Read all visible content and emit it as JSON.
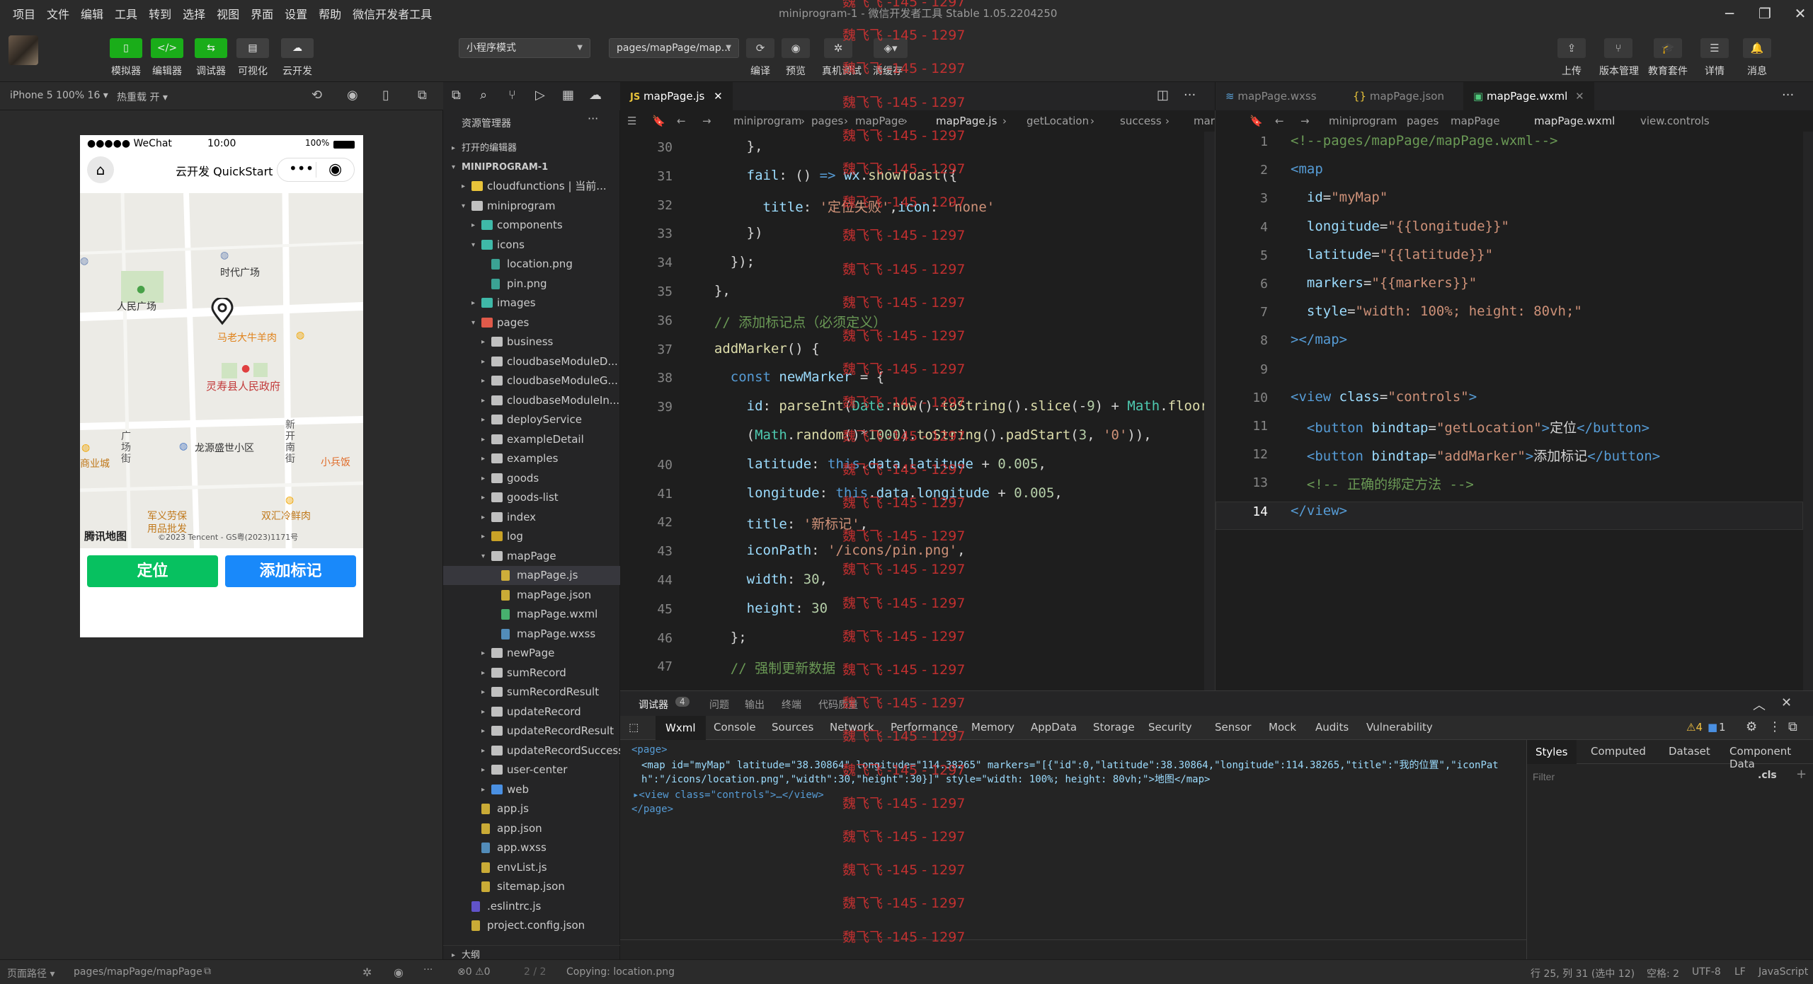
{
  "menu": [
    "项目",
    "文件",
    "编辑",
    "工具",
    "转到",
    "选择",
    "视图",
    "界面",
    "设置",
    "帮助",
    "微信开发者工具"
  ],
  "window_title": "miniprogram-1 - 微信开发者工具 Stable 1.05.2204250",
  "toolbar": {
    "buttons": [
      "模拟器",
      "编辑器",
      "调试器",
      "可视化",
      "云开发"
    ],
    "mode_select": "小程序模式",
    "page_select": "pages/mapPage/map...",
    "actions": [
      "编译",
      "预览",
      "真机调试",
      "清缓存"
    ],
    "right": [
      "上传",
      "版本管理",
      "教育套件",
      "详情",
      "消息"
    ]
  },
  "simulator": {
    "device": "iPhone 5 100% 16 ▾",
    "hot_reload": "热重载 开 ▾",
    "status_left": "●●●●● WeChat",
    "status_time": "10:00",
    "status_batt": "100%",
    "nav_title": "云开发 QuickStart",
    "map_labels": {
      "square": "时代广场",
      "park": "人民广场",
      "restaurant": "马老大牛羊肉",
      "gov": "灵寿县人民政府",
      "community": "龙源盛世小区",
      "mall": "商业城",
      "street1": "新开南街",
      "street2": "广场街",
      "shop": "小兵饭",
      "army": "军义劳保\n用品批发",
      "beef": "双汇冷鲜肉",
      "brand": "腾讯地图",
      "copyright": "©2023 Tencent - GS粤(2023)1171号"
    },
    "btn_locate": "定位",
    "btn_add": "添加标记"
  },
  "explorer": {
    "title": "资源管理器",
    "sections": {
      "open": "打开的编辑器",
      "project": "MINIPROGRAM-1",
      "outline": "大纲"
    },
    "rows": [
      {
        "label": "cloudfunctions | 当前...",
        "depth": 1,
        "type": "folder-cloud",
        "arrow": "▸"
      },
      {
        "label": "miniprogram",
        "depth": 1,
        "type": "folder",
        "arrow": "▾"
      },
      {
        "label": "components",
        "depth": 2,
        "type": "folder-teal",
        "arrow": "▸"
      },
      {
        "label": "icons",
        "depth": 2,
        "type": "folder-teal",
        "arrow": "▾"
      },
      {
        "label": "location.png",
        "depth": 3,
        "type": "img",
        "arrow": ""
      },
      {
        "label": "pin.png",
        "depth": 3,
        "type": "img",
        "arrow": ""
      },
      {
        "label": "images",
        "depth": 2,
        "type": "folder-teal",
        "arrow": "▸"
      },
      {
        "label": "pages",
        "depth": 2,
        "type": "folder-red",
        "arrow": "▾"
      },
      {
        "label": "business",
        "depth": 3,
        "type": "folder",
        "arrow": "▸"
      },
      {
        "label": "cloudbaseModuleD...",
        "depth": 3,
        "type": "folder",
        "arrow": "▸"
      },
      {
        "label": "cloudbaseModuleG...",
        "depth": 3,
        "type": "folder",
        "arrow": "▸"
      },
      {
        "label": "cloudbaseModuleIn...",
        "depth": 3,
        "type": "folder",
        "arrow": "▸"
      },
      {
        "label": "deployService",
        "depth": 3,
        "type": "folder",
        "arrow": "▸"
      },
      {
        "label": "exampleDetail",
        "depth": 3,
        "type": "folder",
        "arrow": "▸"
      },
      {
        "label": "examples",
        "depth": 3,
        "type": "folder",
        "arrow": "▸"
      },
      {
        "label": "goods",
        "depth": 3,
        "type": "folder",
        "arrow": "▸"
      },
      {
        "label": "goods-list",
        "depth": 3,
        "type": "folder",
        "arrow": "▸"
      },
      {
        "label": "index",
        "depth": 3,
        "type": "folder",
        "arrow": "▸"
      },
      {
        "label": "log",
        "depth": 3,
        "type": "folder-yellow",
        "arrow": "▸"
      },
      {
        "label": "mapPage",
        "depth": 3,
        "type": "folder",
        "arrow": "▾"
      },
      {
        "label": "mapPage.js",
        "depth": 4,
        "type": "js",
        "arrow": "",
        "selected": true
      },
      {
        "label": "mapPage.json",
        "depth": 4,
        "type": "json",
        "arrow": ""
      },
      {
        "label": "mapPage.wxml",
        "depth": 4,
        "type": "wxml",
        "arrow": ""
      },
      {
        "label": "mapPage.wxss",
        "depth": 4,
        "type": "wxss",
        "arrow": ""
      },
      {
        "label": "newPage",
        "depth": 3,
        "type": "folder",
        "arrow": "▸"
      },
      {
        "label": "sumRecord",
        "depth": 3,
        "type": "folder",
        "arrow": "▸"
      },
      {
        "label": "sumRecordResult",
        "depth": 3,
        "type": "folder",
        "arrow": "▸"
      },
      {
        "label": "updateRecord",
        "depth": 3,
        "type": "folder",
        "arrow": "▸"
      },
      {
        "label": "updateRecordResult",
        "depth": 3,
        "type": "folder",
        "arrow": "▸"
      },
      {
        "label": "updateRecordSuccess",
        "depth": 3,
        "type": "folder",
        "arrow": "▸"
      },
      {
        "label": "user-center",
        "depth": 3,
        "type": "folder",
        "arrow": "▸"
      },
      {
        "label": "web",
        "depth": 3,
        "type": "folder-blue",
        "arrow": "▸"
      },
      {
        "label": "app.js",
        "depth": 2,
        "type": "js",
        "arrow": ""
      },
      {
        "label": "app.json",
        "depth": 2,
        "type": "json",
        "arrow": ""
      },
      {
        "label": "app.wxss",
        "depth": 2,
        "type": "wxss",
        "arrow": ""
      },
      {
        "label": "envList.js",
        "depth": 2,
        "type": "js",
        "arrow": ""
      },
      {
        "label": "sitemap.json",
        "depth": 2,
        "type": "json",
        "arrow": ""
      },
      {
        "label": ".eslintrc.js",
        "depth": 1,
        "type": "eslint",
        "arrow": ""
      },
      {
        "label": "project.config.json",
        "depth": 1,
        "type": "json",
        "arrow": ""
      }
    ]
  },
  "editor_left": {
    "tab": "mapPage.js",
    "crumbs": [
      "miniprogram",
      "pages",
      "mapPage",
      "mapPage.js",
      "getLocation",
      "success",
      "mark"
    ],
    "lines": [
      {
        "n": "30",
        "html": "      },"
      },
      {
        "n": "31",
        "html": "      <span class='p'>fail</span>: () <span class='b'>=></span> <span class='p'>wx</span>.<span class='f'>showToast</span>({"
      },
      {
        "n": "32",
        "html": "        <span class='p'>title</span>: <span class='s'>'定位失败'</span>,<span class='p'>icon</span>: <span class='s'>'none'</span>"
      },
      {
        "n": "33",
        "html": "      })"
      },
      {
        "n": "34",
        "html": "    });"
      },
      {
        "n": "35",
        "html": "  },"
      },
      {
        "n": "36",
        "html": "  <span class='c'>// 添加标记点（必须定义）</span>"
      },
      {
        "n": "37",
        "html": "  <span class='f'>addMarker</span>() {"
      },
      {
        "n": "38",
        "html": "    <span class='b'>const</span> <span class='p'>newMarker</span> = {"
      },
      {
        "n": "39",
        "html": "      <span class='p'>id</span>: <span class='f'>parseInt</span>(<span class='t'>Date</span>.<span class='f'>now</span>().<span class='f'>toString</span>().<span class='f'>slice</span>(-<span class='n'>9</span>) + <span class='t'>Math</span>.<span class='f'>floor</span>"
      },
      {
        "n": "",
        "html": "      (<span class='t'>Math</span>.<span class='f'>random</span>()*<span class='n'>1000</span>).<span class='f'>toString</span>().<span class='f'>padStart</span>(<span class='n'>3</span>, <span class='s'>'0'</span>)),"
      },
      {
        "n": "40",
        "html": "      <span class='p'>latitude</span>: <span class='b'>this</span>.<span class='p'>data</span>.<span class='p'>latitude</span> + <span class='n'>0.005</span>,"
      },
      {
        "n": "41",
        "html": "      <span class='p'>longitude</span>: <span class='b'>this</span>.<span class='p'>data</span>.<span class='p'>longitude</span> + <span class='n'>0.005</span>,"
      },
      {
        "n": "42",
        "html": "      <span class='p'>title</span>: <span class='s'>'新标记'</span>,"
      },
      {
        "n": "43",
        "html": "      <span class='p'>iconPath</span>: <span class='s'>'/icons/pin.png'</span>,"
      },
      {
        "n": "44",
        "html": "      <span class='p'>width</span>: <span class='n'>30</span>,"
      },
      {
        "n": "45",
        "html": "      <span class='p'>height</span>: <span class='n'>30</span>"
      },
      {
        "n": "46",
        "html": "    };"
      },
      {
        "n": "47",
        "html": "    <span class='c'>// 强制更新数据</span>"
      }
    ]
  },
  "editor_right": {
    "tabs": [
      "mapPage.wxss",
      "mapPage.json",
      "mapPage.wxml"
    ],
    "crumbs": [
      "miniprogram",
      "pages",
      "mapPage",
      "mapPage.wxml",
      "view.controls"
    ],
    "lines": [
      {
        "n": "1",
        "html": "<span class='c'>&lt;!--pages/mapPage/mapPage.wxml--&gt;</span>"
      },
      {
        "n": "2",
        "html": "<span class='tag'>&lt;map</span>"
      },
      {
        "n": "3",
        "html": "  <span class='attr'>id</span>=<span class='val'>\"myMap\"</span>"
      },
      {
        "n": "4",
        "html": "  <span class='attr'>longitude</span>=<span class='val'>\"{{longitude}}\"</span>"
      },
      {
        "n": "5",
        "html": "  <span class='attr'>latitude</span>=<span class='val'>\"{{latitude}}\"</span>"
      },
      {
        "n": "6",
        "html": "  <span class='attr'>markers</span>=<span class='val'>\"{{markers}}\"</span>"
      },
      {
        "n": "7",
        "html": "  <span class='attr'>style</span>=<span class='val'>\"width: 100%; height: 80vh;\"</span>"
      },
      {
        "n": "8",
        "html": "<span class='tag'>&gt;&lt;/map&gt;</span>"
      },
      {
        "n": "9",
        "html": ""
      },
      {
        "n": "10",
        "html": "<span class='tag'>&lt;view</span> <span class='attr'>class</span>=<span class='val'>\"controls\"</span><span class='tag'>&gt;</span>"
      },
      {
        "n": "11",
        "html": "  <span class='tag'>&lt;button</span> <span class='attr'>bindtap</span>=<span class='val'>\"getLocation\"</span><span class='tag'>&gt;</span>定位<span class='tag'>&lt;/button&gt;</span>"
      },
      {
        "n": "12",
        "html": "  <span class='tag'>&lt;button</span> <span class='attr'>bindtap</span>=<span class='val'>\"addMarker\"</span><span class='tag'>&gt;</span>添加标记<span class='tag'>&lt;/button&gt;</span>"
      },
      {
        "n": "13",
        "html": "  <span class='c'>&lt;!-- 正确的绑定方法 --&gt;</span>"
      },
      {
        "n": "14",
        "html": "<span class='tag'>&lt;/view&gt;</span>"
      }
    ]
  },
  "debugger": {
    "top_tabs": [
      "调试器",
      "4",
      "问题",
      "输出",
      "终端",
      "代码质量"
    ],
    "tabs": [
      "Wxml",
      "Console",
      "Sources",
      "Network",
      "Performance",
      "Memory",
      "AppData",
      "Storage",
      "Security",
      "Sensor",
      "Mock",
      "Audits",
      "Vulnerability"
    ],
    "warn_count": "⚠4",
    "info_count": "1",
    "dom_page_open": "<page>",
    "dom_map": "<map id=\"myMap\" latitude=\"38.30864\" longitude=\"114.38265\" markers=\"[{\"id\":0,\"latitude\":38.30864,\"longitude\":114.38265,\"title\":\"我的位置\",\"iconPath\":\"/icons/location.png\",\"width\":30,\"height\":30}]\" style=\"width: 100%; height: 80vh;\">地图</map>",
    "dom_view": "▸<view class=\"controls\">…</view>",
    "dom_page_close": "</page>",
    "style_tabs": [
      "Styles",
      "Computed",
      "Dataset",
      "Component Data"
    ],
    "filter_placeholder": "Filter",
    "cls": ".cls"
  },
  "statusbar": {
    "page_path_label": "页面路径 ▾",
    "page_path": "pages/mapPage/mapPage",
    "errors": "⊗0 ⚠0",
    "pager": "2 / 2",
    "copying": "Copying: location.png",
    "position": "行 25, 列 31 (选中 12)",
    "spaces": "空格: 2",
    "encoding": "UTF-8",
    "eol": "LF",
    "language": "JavaScript"
  },
  "watermark": "魏飞飞 -145 - 1297"
}
